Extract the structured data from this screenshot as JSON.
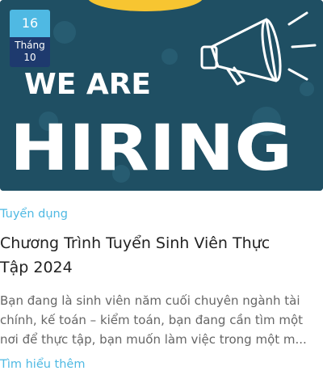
{
  "post": {
    "image_text": {
      "line1": "WE ARE",
      "line2": "HIRING"
    },
    "date": {
      "day": "16",
      "month_label": "Tháng",
      "month": "10"
    },
    "category": "Tuyển dụng",
    "title_lines": [
      "Chương Trình Tuyển Sinh Viên Thực",
      "Tập 2024"
    ],
    "excerpt_lines": [
      "Bạn đang là sinh viên năm cuối chuyên ngành tài",
      "chính, kế toán – kiểm toán, bạn đang cần tìm một",
      "nơi để thực tập, bạn muốn làm việc trong một m..."
    ],
    "read_more": "Tìm hiểu thêm"
  },
  "colors": {
    "accent": "#4fb9e3",
    "badge_bottom": "#1e3a6e",
    "image_bg": "#1f4f63",
    "sun": "#f7c531"
  }
}
